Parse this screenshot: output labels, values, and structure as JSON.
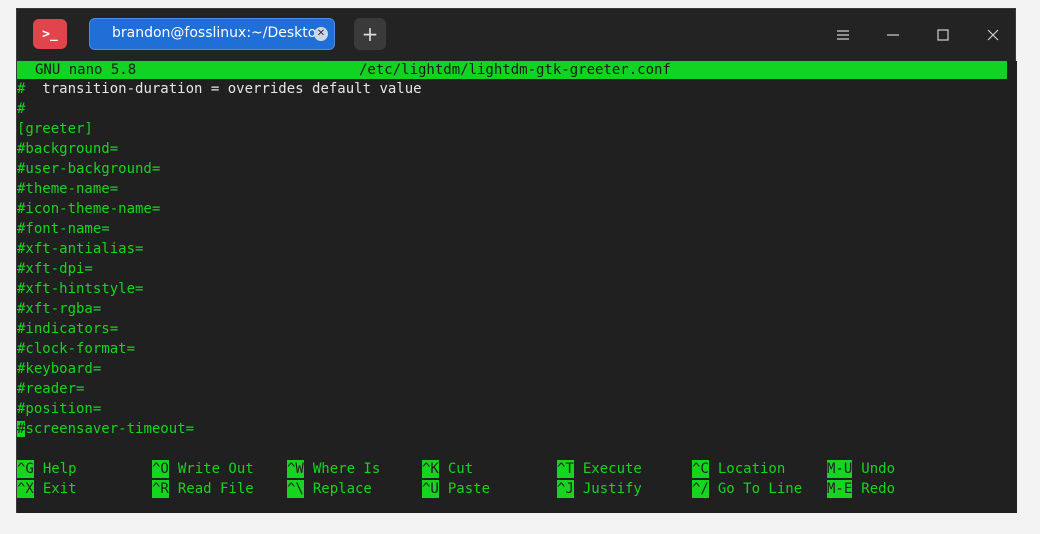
{
  "titlebar": {
    "app_icon_text": ">_",
    "tab_label": "brandon@fosslinux:~/Desktop",
    "tab_close_icon": "close-icon",
    "new_tab_icon": "plus-icon"
  },
  "window_controls": [
    "menu-icon",
    "minimize-icon",
    "maximize-icon",
    "close-icon"
  ],
  "nano": {
    "version": "GNU nano 5.8",
    "file": "/etc/lightdm/lightdm-gtk-greeter.conf",
    "lines": [
      "#  transition-duration = overrides default value",
      "#",
      "[greeter]",
      "#background=",
      "#user-background=",
      "#theme-name=",
      "#icon-theme-name=",
      "#font-name=",
      "#xft-antialias=",
      "#xft-dpi=",
      "#xft-hintstyle=",
      "#xft-rgba=",
      "#indicators=",
      "#clock-format=",
      "#keyboard=",
      "#reader=",
      "#position=",
      "#screensaver-timeout="
    ],
    "shortcuts_row1": [
      {
        "key": "^G",
        "label": "Help"
      },
      {
        "key": "^O",
        "label": "Write Out"
      },
      {
        "key": "^W",
        "label": "Where Is"
      },
      {
        "key": "^K",
        "label": "Cut"
      },
      {
        "key": "^T",
        "label": "Execute"
      },
      {
        "key": "^C",
        "label": "Location"
      },
      {
        "key": "M-U",
        "label": "Undo"
      }
    ],
    "shortcuts_row2": [
      {
        "key": "^X",
        "label": "Exit"
      },
      {
        "key": "^R",
        "label": "Read File"
      },
      {
        "key": "^\\",
        "label": "Replace"
      },
      {
        "key": "^U",
        "label": "Paste"
      },
      {
        "key": "^J",
        "label": "Justify"
      },
      {
        "key": "^/",
        "label": "Go To Line"
      },
      {
        "key": "M-E",
        "label": "Redo"
      }
    ]
  },
  "colors": {
    "accent_green": "#16d51f",
    "background": "#202020",
    "tab_blue": "#1f6fd6",
    "app_icon_red": "#e2444c"
  }
}
